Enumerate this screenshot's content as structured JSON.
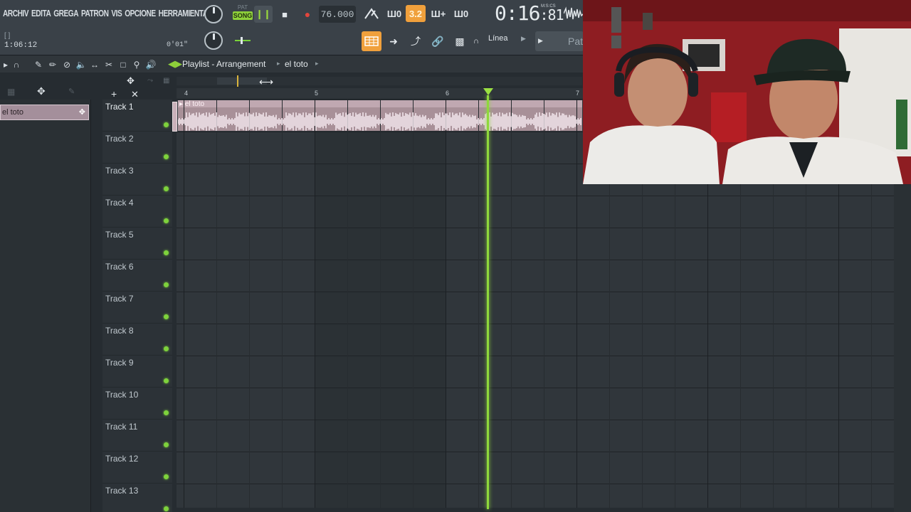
{
  "menu": [
    "ARCHIV",
    "EDITA",
    "GREGA",
    "PATRON",
    "VIS",
    "OPCIONE",
    "HERRAMIENTA"
  ],
  "hint": {
    "brackets": "[ ]",
    "time": "1:06:12",
    "duration": "0'01\""
  },
  "transport": {
    "pat_label": "PAT",
    "song_label": "SONG",
    "play_icon": "pause-icon",
    "stop_icon": "stop-icon",
    "record_icon": "record-icon",
    "tempo": "76.000",
    "typing_keyboard": "3.2",
    "song_time_main": "0:16",
    "song_time_sub": ":81",
    "song_time_label": "M:S:CS"
  },
  "toolbar2": {
    "snap": "Línea",
    "pattern": "Patr"
  },
  "playlist": {
    "title": "Playlist - Arrangement",
    "breadcrumb": "el toto",
    "ruler": [
      "4",
      "5",
      "6",
      "7"
    ],
    "picker_item": "el toto",
    "clip_label": "el toto",
    "tracks": [
      "Track 1",
      "Track 2",
      "Track 3",
      "Track 4",
      "Track 5",
      "Track 6",
      "Track 7",
      "Track 8",
      "Track 9",
      "Track 10",
      "Track 11",
      "Track 12",
      "Track 13"
    ]
  },
  "colors": {
    "accent": "#f0a03c",
    "song_green": "#8fd13a",
    "playhead": "#8fd83c",
    "clip": "#a89098",
    "record": "#e2453c"
  }
}
